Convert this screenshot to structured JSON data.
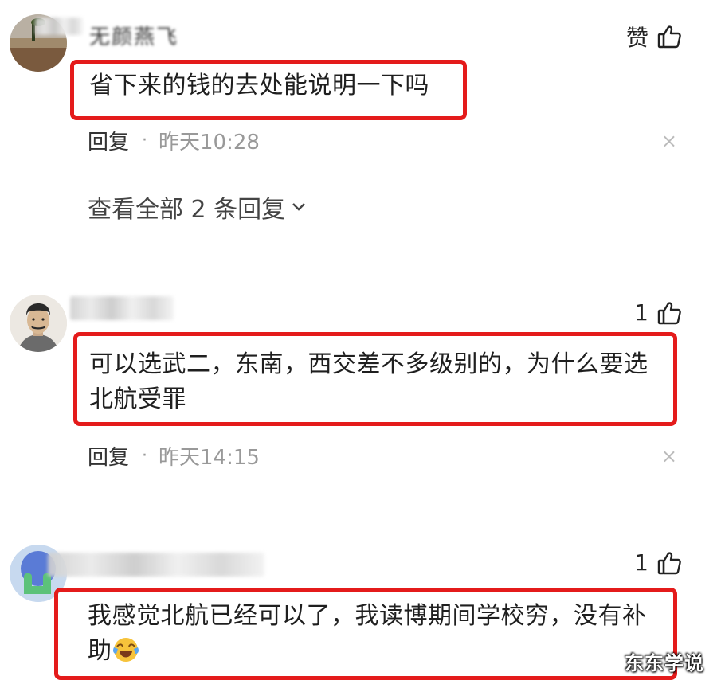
{
  "comments": [
    {
      "author": "无颜燕飞",
      "like_label": "赞",
      "text": "省下来的钱的去处能说明一下吗",
      "reply_label": "回复",
      "dot": "·",
      "time": "昨天10:28",
      "close": "×",
      "view_all": "查看全部 2 条回复"
    },
    {
      "like_count": "1",
      "text": "可以选武二，东南，西交差不多级别的，为什么要选北航受罪",
      "reply_label": "回复",
      "dot": "·",
      "time": "昨天14:15",
      "close": "×"
    },
    {
      "like_count": "1",
      "text": "我感觉北航已经可以了，我读博期间学校穷，没有补助"
    }
  ],
  "watermark": "东东学说",
  "colors": {
    "highlight": "#e41b1b",
    "meta_gray": "#999999"
  },
  "icons": [
    "thumbs-up-icon",
    "chevron-down-icon",
    "close-icon",
    "crying-laughing-emoji"
  ]
}
